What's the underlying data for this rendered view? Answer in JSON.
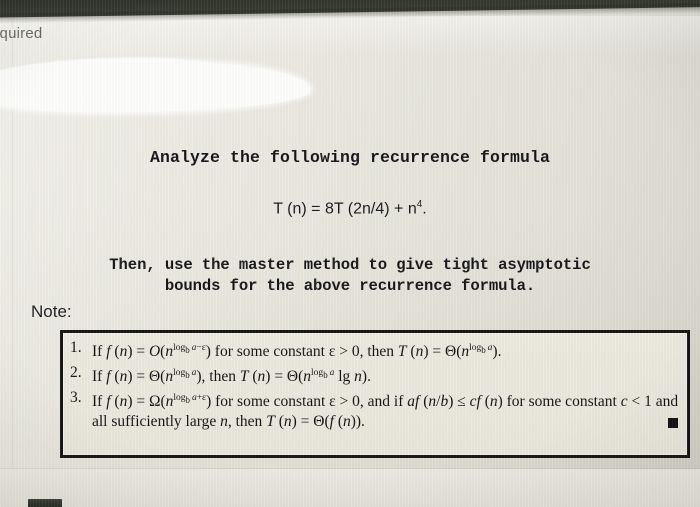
{
  "photo": {
    "device_hint": "screen-photo",
    "background_color": "#e9e7dd",
    "bezel_color": "#2a2d25",
    "ink_color": "#141414"
  },
  "partial_header": {
    "visible_text": "equired",
    "full_word_guess": "Required"
  },
  "redaction": {
    "name": "white-highlighter-stroke",
    "color": "#fdfdfb"
  },
  "question": {
    "heading": "Analyze the following recurrence formula",
    "formula": {
      "prefix": "T (n) = 8T (2n/4) + n",
      "exponent": "4",
      "suffix": "."
    },
    "instruction_line_1": "Then, use the master method to give tight asymptotic",
    "instruction_line_2": "bounds for the above recurrence formula.",
    "note_label": "Note:"
  },
  "theorem_box": {
    "qed_marker": "■",
    "cases": [
      {
        "number": "1.",
        "parts": [
          {
            "t": "If ",
            "style": "roman"
          },
          {
            "t": "f",
            "style": "italic"
          },
          {
            "t": " (",
            "style": "roman"
          },
          {
            "t": "n",
            "style": "italic"
          },
          {
            "t": ") = ",
            "style": "roman"
          },
          {
            "t": "O",
            "style": "italic"
          },
          {
            "t": "(",
            "style": "roman"
          },
          {
            "t": "n",
            "style": "italic"
          },
          {
            "t": "log",
            "style": "sup"
          },
          {
            "t": "b",
            "style": "sup-sub"
          },
          {
            "t": " a−ϵ",
            "style": "sup-italic"
          },
          {
            "t": ") for some constant ",
            "style": "roman"
          },
          {
            "t": "ϵ",
            "style": "italic"
          },
          {
            "t": " > 0, then ",
            "style": "roman"
          },
          {
            "t": "T",
            "style": "italic"
          },
          {
            "t": " (",
            "style": "roman"
          },
          {
            "t": "n",
            "style": "italic"
          },
          {
            "t": ") = Θ(",
            "style": "roman"
          },
          {
            "t": "n",
            "style": "italic"
          },
          {
            "t": "log",
            "style": "sup"
          },
          {
            "t": "b",
            "style": "sup-sub"
          },
          {
            "t": " a",
            "style": "sup-italic"
          },
          {
            "t": ").",
            "style": "roman"
          }
        ],
        "plain": "If f (n) = O(n^{log_b a-ϵ}) for some constant ϵ > 0, then T (n) = Θ(n^{log_b a})."
      },
      {
        "number": "2.",
        "plain": "If f (n) = Θ(n^{log_b a}), then T (n) = Θ(n^{log_b a} lg n)."
      },
      {
        "number": "3.",
        "plain": "If f (n) = Ω(n^{log_b a+ϵ}) for some constant ϵ > 0, and if af (n/b) ≤ cf (n) for some constant c < 1 and all sufficiently large n, then T (n) = Θ(f (n))."
      }
    ],
    "case3_line1_tail": "for",
    "case3_line2": "some constant c < 1 and all sufficiently large n, then T (n) = Θ(f (n))."
  }
}
